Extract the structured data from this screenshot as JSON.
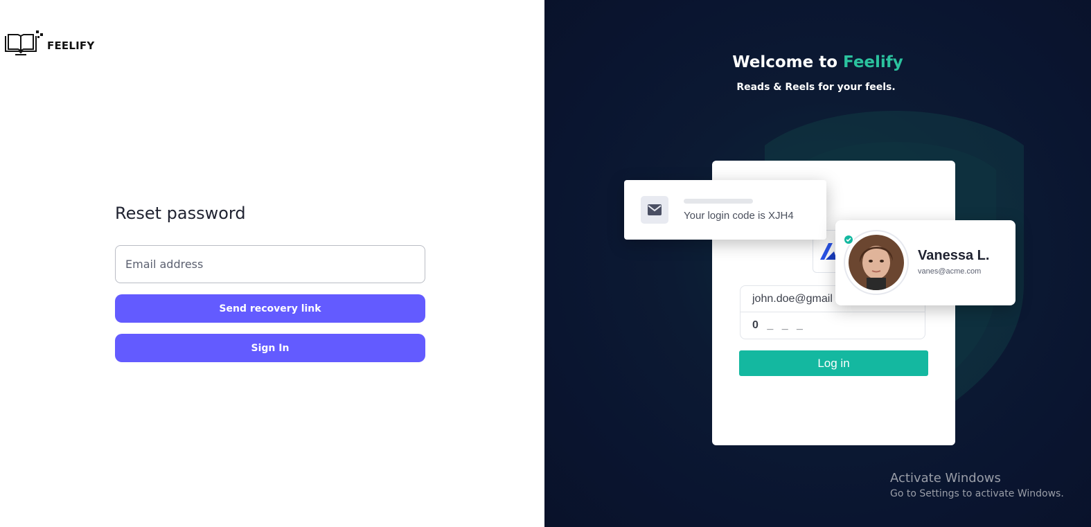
{
  "brand": {
    "name": "FEELIFY"
  },
  "reset": {
    "title": "Reset password",
    "email_placeholder": "Email address",
    "send_label": "Send recovery link",
    "signin_label": "Sign In"
  },
  "hero": {
    "welcome_prefix": "Welcome to ",
    "welcome_brand": "Feelify",
    "tagline": "Reads & Reels for your feels.",
    "notification": {
      "message": "Your login code is XJH4"
    },
    "login_card": {
      "email_value": "john.doe@gmail",
      "code_value": "0 _ _ _",
      "login_label": "Log in"
    },
    "profile": {
      "name": "Vanessa L.",
      "email": "vanes@acme.com"
    }
  },
  "os_watermark": {
    "title": "Activate Windows",
    "subtitle": "Go to Settings to activate Windows."
  },
  "colors": {
    "primary": "#635bff",
    "accent": "#2bc29e",
    "login_button": "#14b8a0",
    "hero_bg": "#0a1530"
  },
  "icons": [
    "book-logo-icon",
    "envelope-icon",
    "verified-check-icon",
    "shield-background-icon"
  ]
}
